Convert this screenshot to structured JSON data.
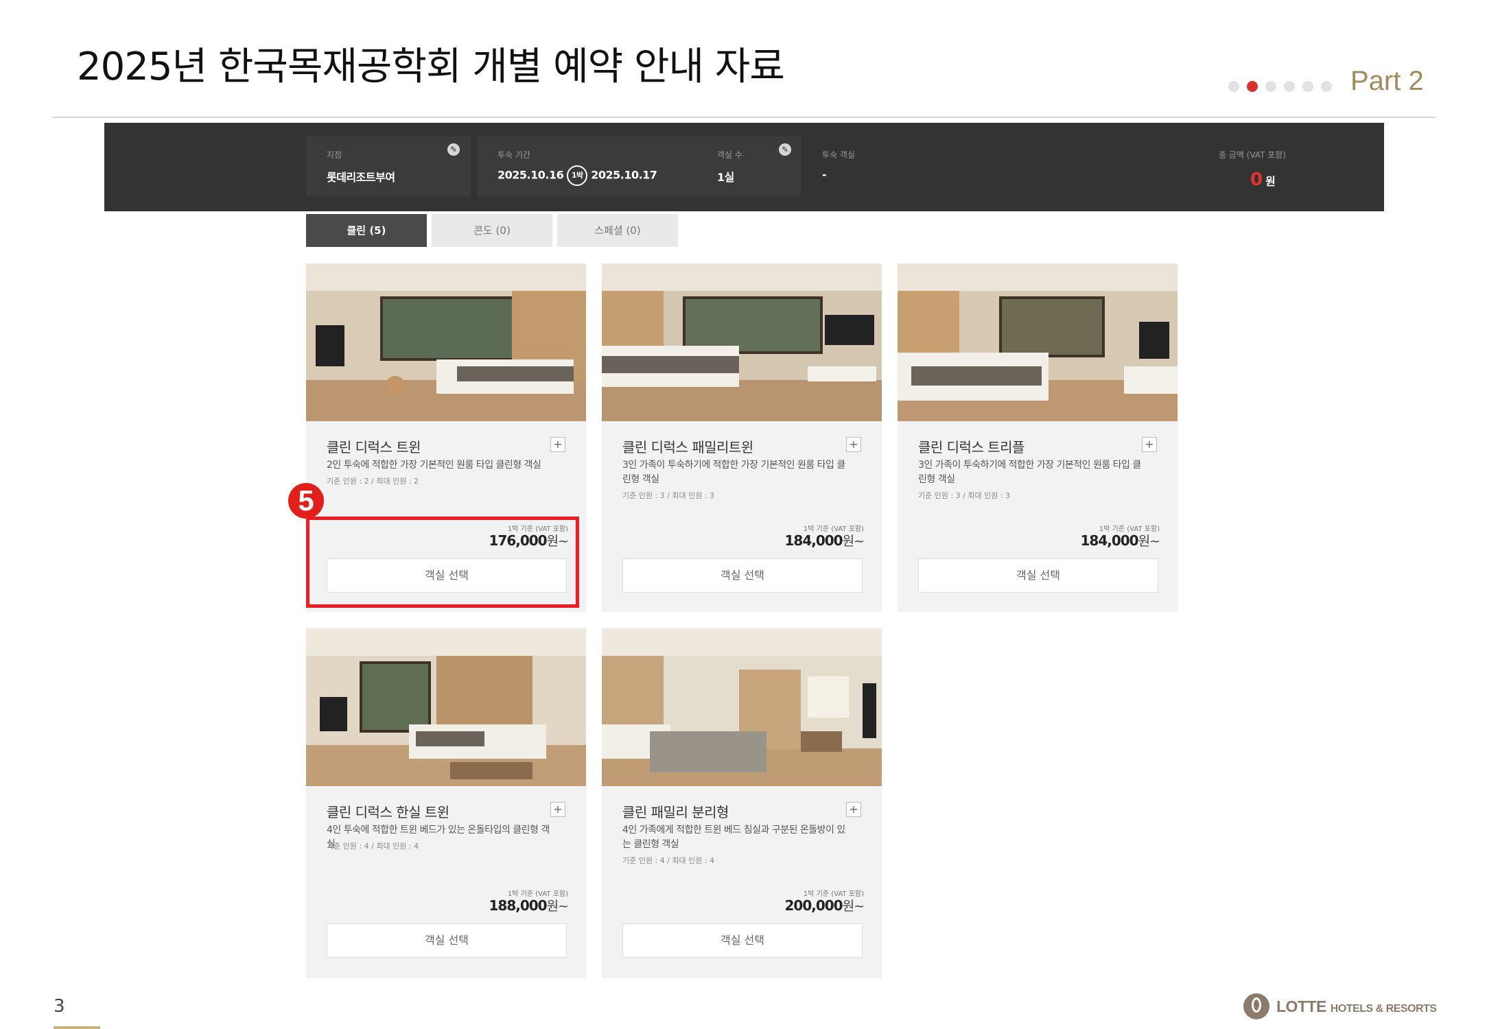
{
  "slide": {
    "title": "2025년 한국목재공학회 개별 예약 안내 자료",
    "part_label": "Part 2",
    "page_number": "3"
  },
  "booking_bar": {
    "branch_label": "지점",
    "branch_value": "롯데리조트부여",
    "period_label": "투숙 기간",
    "checkin": "2025.10.16",
    "nights": "1박",
    "checkout": "2025.10.17",
    "rooms_label": "객실 수",
    "rooms_value": "1실",
    "room_type_label": "투숙 객실",
    "room_type_value": "-",
    "total_label": "총 금액 (VAT 포함)",
    "total_value": "0",
    "total_unit": "원"
  },
  "tabs": [
    {
      "label": "클린 (5)",
      "active": true
    },
    {
      "label": "콘도 (0)",
      "active": false
    },
    {
      "label": "스페셜 (0)",
      "active": false
    }
  ],
  "rooms": [
    {
      "name": "클린 디럭스 트윈",
      "description": "2인 투숙에 적합한 가장 기본적인 원룸 타입 클린형 객실",
      "occupancy": "기준 인원 : 2 / 최대 인원 : 2",
      "price_note": "1박 기준 (VAT 포함)",
      "price": "176,000",
      "price_suffix": "원~",
      "select_label": "객실 선택"
    },
    {
      "name": "클린 디럭스 패밀리트윈",
      "description": "3인 가족이 투숙하기에 적합한 가장 기본적인 원룸 타입 클린형 객실",
      "occupancy": "기준 인원 : 3 / 최대 인원 : 3",
      "price_note": "1박 기준 (VAT 포함)",
      "price": "184,000",
      "price_suffix": "원~",
      "select_label": "객실 선택"
    },
    {
      "name": "클린 디럭스 트리플",
      "description": "3인 가족이 투숙하기에 적합한 가장 기본적인 원룸 타입 클린형 객실",
      "occupancy": "기준 인원 : 3 / 최대 인원 : 3",
      "price_note": "1박 기준 (VAT 포함)",
      "price": "184,000",
      "price_suffix": "원~",
      "select_label": "객실 선택"
    },
    {
      "name": "클린 디럭스 한실 트윈",
      "description": "4인 투숙에 적합한 트윈 베드가 있는 온돌타입의 클린형 객실",
      "occupancy": "기준 인원 : 4 / 최대 인원 : 4",
      "price_note": "1박 기준 (VAT 포함)",
      "price": "188,000",
      "price_suffix": "원~",
      "select_label": "객실 선택"
    },
    {
      "name": "클린 패밀리 분리형",
      "description": "4인 가족에게 적합한 트윈 베드 침실과 구분된 온돌방이 있는 클린형 객실",
      "occupancy": "기준 인원 : 4 / 최대 인원 : 4",
      "price_note": "1박 기준 (VAT 포함)",
      "price": "200,000",
      "price_suffix": "원~",
      "select_label": "객실 선택"
    }
  ],
  "annotation": {
    "step_number": "5"
  },
  "logo": {
    "brand": "LOTTE",
    "tagline": "HOTELS & RESORTS"
  },
  "colors": {
    "accent_red": "#e8322d",
    "gold": "#a38a5c",
    "bar_dark": "#333333"
  }
}
